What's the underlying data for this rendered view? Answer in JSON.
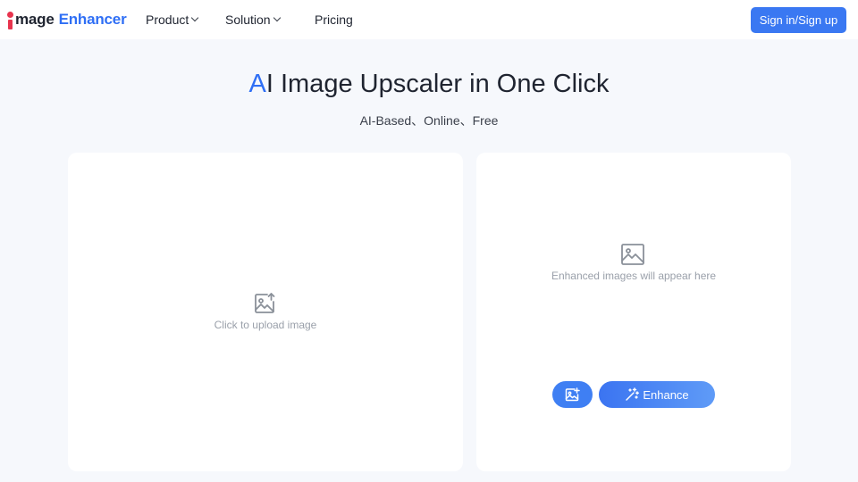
{
  "header": {
    "logo_word_a": "mage",
    "logo_word_b": "Enhancer",
    "nav": {
      "product_label": "Product",
      "solution_label": "Solution",
      "pricing_label": "Pricing"
    },
    "signin_label": "Sign in/Sign up"
  },
  "hero": {
    "title_accent": "A",
    "title_rest": "I Image Upscaler in One Click",
    "subtitle": "AI-Based、Online、Free"
  },
  "upload_panel": {
    "icon": "image-upload-icon",
    "text": "Click to upload image"
  },
  "result_panel": {
    "icon": "image-icon",
    "text": "Enhanced images will appear here",
    "add_image_icon": "add-image-icon",
    "enhance_icon": "magic-wand-icon",
    "enhance_label": "Enhance"
  },
  "colors": {
    "brand_blue": "#2f6ff5",
    "logo_red": "#e8344e",
    "background": "#f6f8fc",
    "placeholder_text": "#9aa0aa"
  }
}
